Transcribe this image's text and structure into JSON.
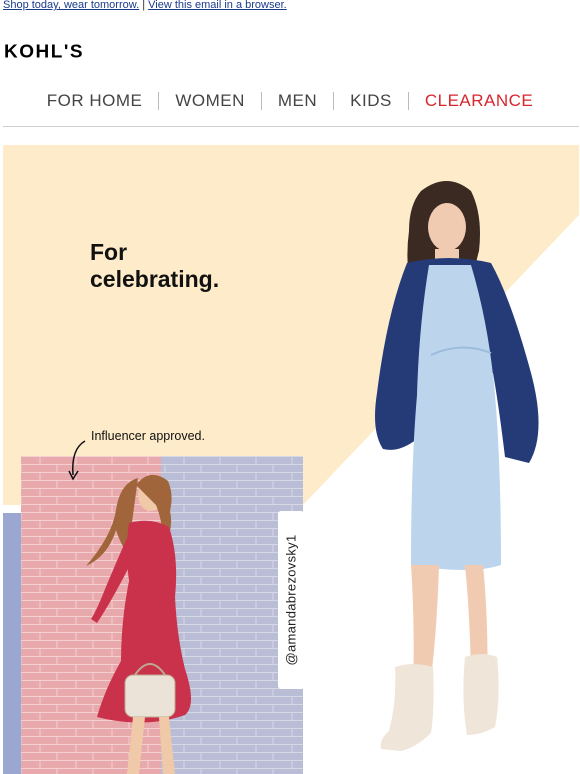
{
  "preheader": {
    "shop_link": "Shop today, wear tomorrow.",
    "separator": "|",
    "browser_link": "View this email in a browser."
  },
  "logo": {
    "text": "KOHL'S"
  },
  "nav": {
    "items": [
      {
        "label": "FOR HOME"
      },
      {
        "label": "WOMEN"
      },
      {
        "label": "MEN"
      },
      {
        "label": "KIDS"
      },
      {
        "label": "CLEARANCE"
      }
    ]
  },
  "hero": {
    "headline_line1": "For",
    "headline_line2": "celebrating.",
    "influencer_label": "Influencer approved.",
    "influencer_handle": "@amandabrezovsky1"
  },
  "colors": {
    "accent_clearance": "#d8262e",
    "hero_cream": "#fdebc9",
    "link_blue": "#1a3a8a",
    "brick_pink": "#e8a9ad",
    "brick_lilac": "#b9bdd6"
  }
}
